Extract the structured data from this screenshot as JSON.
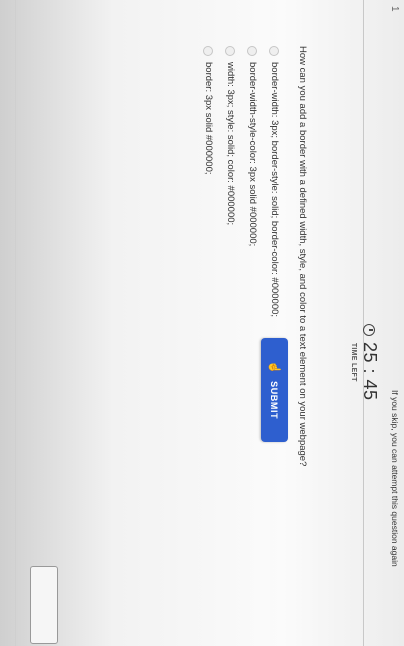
{
  "question_number": "1",
  "timer": {
    "value": "25 : 45",
    "label": "TIME LEFT",
    "icon": "clock-icon"
  },
  "question": "How can you add a border with a defined width, style, and color to a text element on your webpage?",
  "options": [
    "border-width: 3px; border-style: solid; border-color: #000000;",
    "border-width-style-color: 3px solid #000000;",
    "width: 3px; style: solid; color: #000000;",
    "border: 3px solid #000000;"
  ],
  "submit": {
    "label": "SUBMIT",
    "icon": "pointer-hand-icon",
    "color": "#2e5fcf"
  },
  "skip_note": "If you skip, you can attempt this question again"
}
